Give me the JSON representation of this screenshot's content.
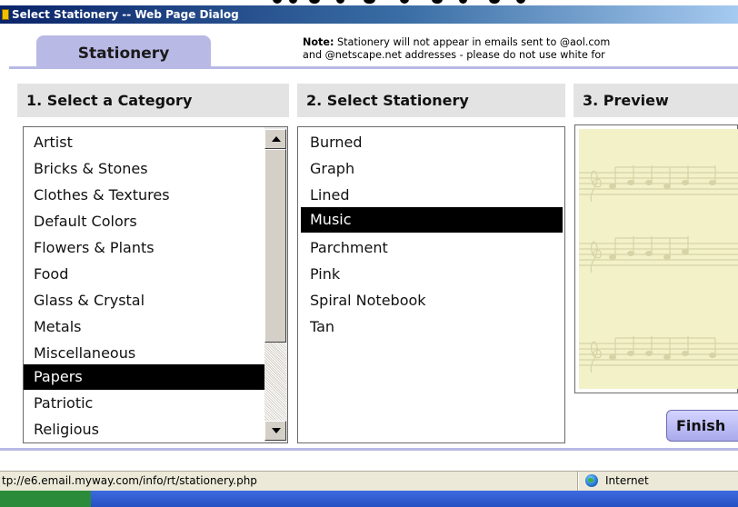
{
  "window": {
    "title": "Select Stationery -- Web Page Dialog"
  },
  "tab": {
    "label": "Stationery"
  },
  "note": {
    "label": "Note:",
    "line1_text": " Stationery will not appear in emails sent to @aol.com",
    "line2_text": "and @netscape.net addresses - please do not use white for"
  },
  "columns": {
    "category_header": "1. Select a Category",
    "stationery_header": "2. Select Stationery",
    "preview_header": "3. Preview"
  },
  "categories": {
    "items": [
      "Artist",
      "Bricks & Stones",
      "Clothes & Textures",
      "Default Colors",
      "Flowers & Plants",
      "Food",
      "Glass & Crystal",
      "Metals",
      "Miscellaneous",
      "Papers",
      "Patriotic",
      "Religious"
    ],
    "selected": "Papers"
  },
  "stationery": {
    "items": [
      "Burned",
      "Graph",
      "Lined",
      "Music",
      "Parchment",
      "Pink",
      "Spiral Notebook",
      "Tan"
    ],
    "selected": "Music"
  },
  "preview": {
    "image": "music-staff-stationery",
    "background_color": "#f2f1c8",
    "ink_color": "#d6d4a6"
  },
  "buttons": {
    "finish_label": "Finish"
  },
  "statusbar": {
    "url_text": "tp://e6.email.myway.com/info/rt/stationery.php",
    "zone_icon": "internet-globe-icon",
    "zone_text": "Internet"
  },
  "colors": {
    "tab": "#b9b9e6",
    "header_bg": "#e3e3e3",
    "selection": "#000000"
  }
}
